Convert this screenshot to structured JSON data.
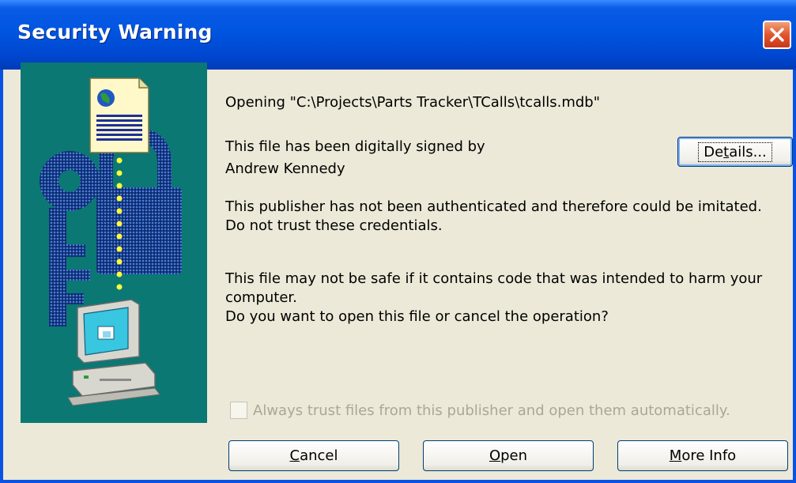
{
  "window": {
    "title": "Security Warning"
  },
  "message": {
    "opening_line": "Opening \"C:\\Projects\\Parts Tracker\\TCalls\\tcalls.mdb\"",
    "signed_by_line": "This file has been digitally signed by",
    "publisher_name": "Andrew Kennedy",
    "not_authenticated_line1": "This publisher has not been authenticated and therefore could be imitated.",
    "not_authenticated_line2": "Do not trust these credentials.",
    "warning_line1": "This file may not be safe if it contains code that was intended to harm your",
    "warning_line2": "computer.",
    "warning_line3": "Do you want to open this file or cancel the operation?"
  },
  "checkbox": {
    "label": "Always trust files from this publisher and open them automatically.",
    "checked": false,
    "enabled": false
  },
  "buttons": {
    "details": {
      "label_pre": "De",
      "label_ul": "t",
      "label_post": "ails..."
    },
    "cancel": {
      "label_ul": "C",
      "label_post": "ancel"
    },
    "open": {
      "label_ul": "O",
      "label_post": "pen"
    },
    "more_info": {
      "label_pre": "",
      "label_ul": "M",
      "label_post": "ore Info"
    }
  },
  "icons": {
    "close": "close-icon",
    "illustration": "security-signed-document-illustration"
  },
  "colors": {
    "title_bar": "#0055e0",
    "close_button": "#e2552e",
    "illustration_bg": "#0b7873",
    "dialog_bg": "#ece9d8"
  }
}
